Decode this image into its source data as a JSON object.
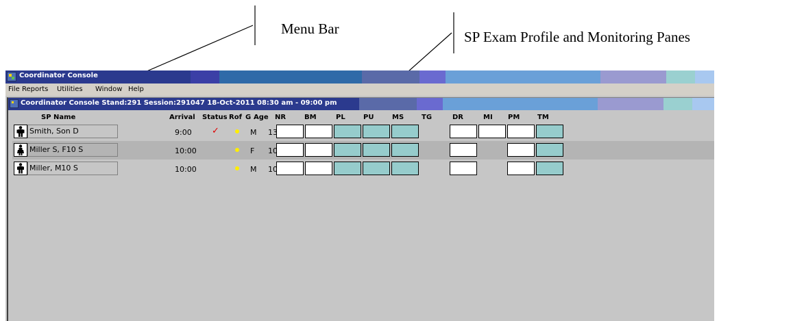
{
  "annotations": {
    "menu_bar": "Menu Bar",
    "panes": "SP Exam Profile and Monitoring Panes"
  },
  "window": {
    "title": "Coordinator Console",
    "menu": [
      "File",
      "Reports",
      "Utilities",
      "Window",
      "Help"
    ],
    "subtitle": "Coordinator Console Stand:291 Session:291047 18-Oct-2011 08:30 am - 09:00 pm"
  },
  "table": {
    "headers": [
      "SP Name",
      "Arrival",
      "Status",
      "Rof",
      "G",
      "Age",
      "NR",
      "BM",
      "PL",
      "PU",
      "MS",
      "TG",
      "DR",
      "MI",
      "PM",
      "TM"
    ],
    "rows": [
      {
        "icon": "person-male-icon",
        "name": "Smith, Son D",
        "arrival": "9:00",
        "status": "✓",
        "gender": "M",
        "age": "13"
      },
      {
        "icon": "person-female-icon",
        "name": "Miller S, F10 S",
        "arrival": "10:00",
        "status": "",
        "gender": "F",
        "age": "10"
      },
      {
        "icon": "person-male-icon",
        "name": "Miller, M10 S",
        "arrival": "10:00",
        "status": "",
        "gender": "M",
        "age": "10"
      }
    ]
  },
  "colors": {
    "status_check": "#e00000",
    "rof_dot": "#ffee00",
    "monitoring_pane": "#96cccc",
    "profile_pane": "#ffffff"
  }
}
